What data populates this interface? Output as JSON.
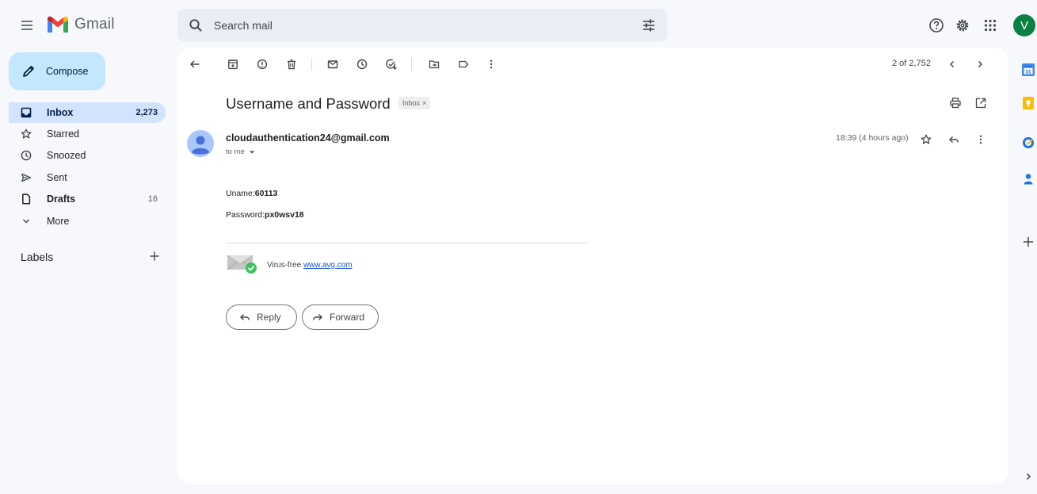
{
  "app": {
    "name": "Gmail"
  },
  "search": {
    "placeholder": "Search mail"
  },
  "account": {
    "initial": "V"
  },
  "compose": {
    "label": "Compose"
  },
  "nav": {
    "inbox": {
      "label": "Inbox",
      "count": "2,273"
    },
    "starred": {
      "label": "Starred"
    },
    "snoozed": {
      "label": "Snoozed"
    },
    "sent": {
      "label": "Sent"
    },
    "drafts": {
      "label": "Drafts",
      "count": "16"
    },
    "more": {
      "label": "More"
    }
  },
  "labels": {
    "title": "Labels"
  },
  "toolbar": {
    "pager": "2 of 2,752"
  },
  "email": {
    "subject": "Username and Password",
    "tag": "Inbox",
    "tag_close": "×",
    "sender": "cloudauthentication24@gmail.com",
    "to": "to me",
    "time": "18:39 (4 hours ago)",
    "uname_label": "Uname:",
    "uname_value": "60113",
    "password_label": "Password:",
    "password_value": "px0wsv18",
    "avg_text": "Virus-free",
    "avg_link": "www.avg.com"
  },
  "actions": {
    "reply": "Reply",
    "forward": "Forward"
  },
  "colors": {
    "accent": "#0b57d0",
    "compose_bg": "#c2e7ff",
    "active_nav_bg": "#d3e3fd",
    "avatar_bg": "#0b8043"
  }
}
